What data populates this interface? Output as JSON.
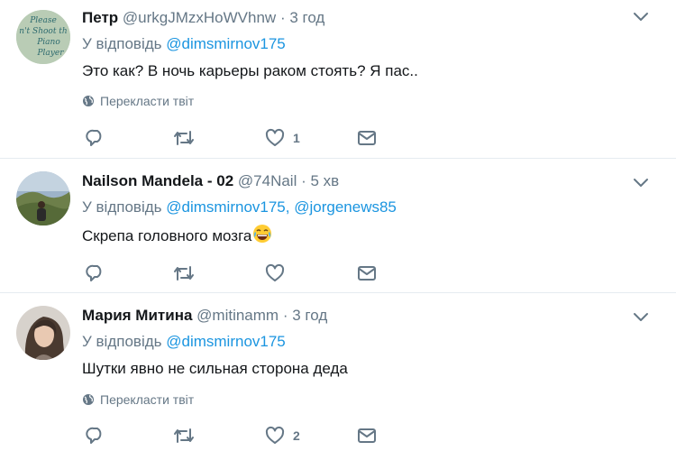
{
  "tweets": [
    {
      "name": "Петр",
      "handle": "@urkgJMzxHoWVhnw",
      "sep": "·",
      "time": "3 год",
      "reply_prefix": "У відповідь",
      "mentions": [
        "@dimsmirnov175"
      ],
      "text": "Это как? В ночь карьеры раком стоять? Я пас..",
      "translate_label": "Перекласти твіт",
      "counts": {
        "reply": "",
        "retweet": "",
        "like": "1"
      },
      "avatar_text": [
        "Please",
        "n't Shoot th",
        "Piano",
        "Player"
      ]
    },
    {
      "name": "Nailson Mandela - 02",
      "handle": "@74Nail",
      "sep": "·",
      "time": "5 хв",
      "reply_prefix": "У відповідь",
      "mentions": [
        "@dimsmirnov175",
        "@jorgenews85"
      ],
      "mention_separator": ",",
      "text": "Скрепа головного мозга",
      "emoji": "face-with-tears-of-joy",
      "counts": {
        "reply": "",
        "retweet": "",
        "like": ""
      }
    },
    {
      "name": "Мария Митина",
      "handle": "@mitinamm",
      "sep": "·",
      "time": "3 год",
      "reply_prefix": "У відповідь",
      "mentions": [
        "@dimsmirnov175"
      ],
      "text": "Шутки явно не сильная сторона деда",
      "translate_label": "Перекласти твіт",
      "counts": {
        "reply": "",
        "retweet": "",
        "like": "2"
      }
    }
  ],
  "colors": {
    "link": "#1b95e0",
    "muted": "#657786",
    "text": "#14171a",
    "divider": "#e6ecf0"
  },
  "icons": [
    "reply-icon",
    "retweet-icon",
    "like-icon",
    "dm-icon",
    "globe-icon",
    "chevron-down-icon"
  ]
}
